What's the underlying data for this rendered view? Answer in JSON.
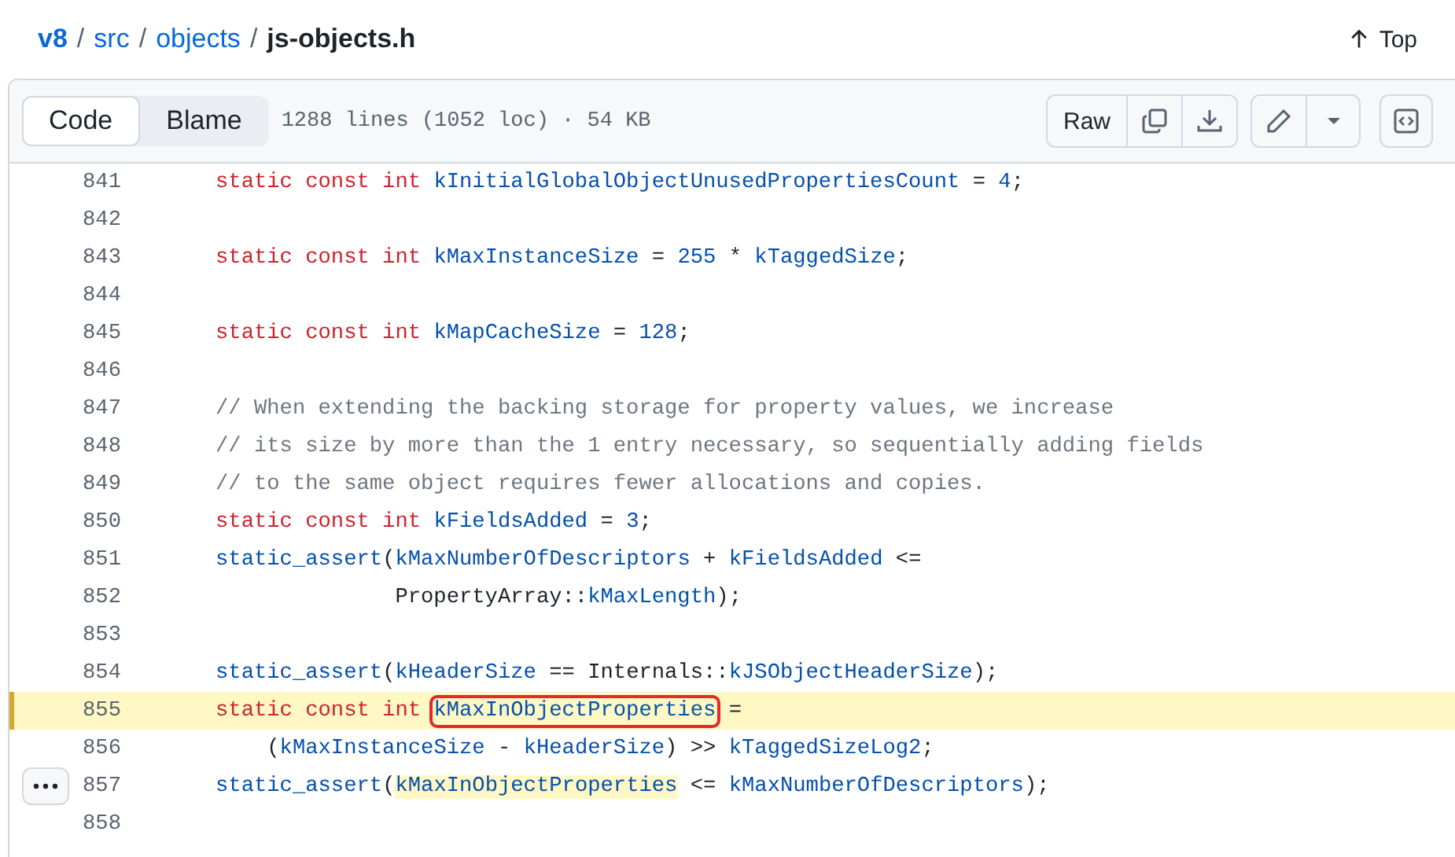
{
  "breadcrumb": {
    "items": [
      "v8",
      "src",
      "objects"
    ],
    "separator": "/",
    "current": "js-objects.h"
  },
  "top_link": {
    "label": "Top"
  },
  "toolbar": {
    "tabs": [
      {
        "label": "Code",
        "selected": true
      },
      {
        "label": "Blame",
        "selected": false
      }
    ],
    "file_info": "1288 lines (1052 loc) · 54 KB",
    "raw_button": "Raw"
  },
  "code": {
    "lines": [
      {
        "number": "841",
        "selected": false,
        "tokens": [
          {
            "t": "static const int ",
            "kind": "kw"
          },
          {
            "t": "kInitialGlobalObjectUnusedPropertiesCount",
            "kind": "id"
          },
          {
            "t": " = ",
            "kind": "p"
          },
          {
            "t": "4",
            "kind": "num"
          },
          {
            "t": ";",
            "kind": "p"
          }
        ]
      },
      {
        "number": "842",
        "selected": false
      },
      {
        "number": "843",
        "selected": false,
        "tokens": [
          {
            "t": "static const int ",
            "kind": "kw"
          },
          {
            "t": "kMaxInstanceSize",
            "kind": "id"
          },
          {
            "t": " = ",
            "kind": "p"
          },
          {
            "t": "255",
            "kind": "num"
          },
          {
            "t": " * ",
            "kind": "p"
          },
          {
            "t": "kTaggedSize",
            "kind": "id"
          },
          {
            "t": ";",
            "kind": "p"
          }
        ]
      },
      {
        "number": "844",
        "selected": false
      },
      {
        "number": "845",
        "selected": false,
        "tokens": [
          {
            "t": "static const int ",
            "kind": "kw"
          },
          {
            "t": "kMapCacheSize",
            "kind": "id"
          },
          {
            "t": " = ",
            "kind": "p"
          },
          {
            "t": "128",
            "kind": "num"
          },
          {
            "t": ";",
            "kind": "p"
          }
        ]
      },
      {
        "number": "846",
        "selected": false
      },
      {
        "number": "847",
        "selected": false,
        "tokens": [
          {
            "t": "// When extending the backing storage for property values, we increase",
            "kind": "comment"
          }
        ]
      },
      {
        "number": "848",
        "selected": false,
        "tokens": [
          {
            "t": "// its size by more than the 1 entry necessary, so sequentially adding fields",
            "kind": "comment"
          }
        ]
      },
      {
        "number": "849",
        "selected": false,
        "tokens": [
          {
            "t": "// to the same object requires fewer allocations and copies.",
            "kind": "comment"
          }
        ]
      },
      {
        "number": "850",
        "selected": false,
        "tokens": [
          {
            "t": "static const int ",
            "kind": "kw"
          },
          {
            "t": "kFieldsAdded",
            "kind": "id"
          },
          {
            "t": " = ",
            "kind": "p"
          },
          {
            "t": "3",
            "kind": "num"
          },
          {
            "t": ";",
            "kind": "p"
          }
        ]
      },
      {
        "number": "851",
        "selected": false,
        "tokens": [
          {
            "t": "static_assert",
            "kind": "id"
          },
          {
            "t": "(",
            "kind": "p"
          },
          {
            "t": "kMaxNumberOfDescriptors",
            "kind": "id"
          },
          {
            "t": " + ",
            "kind": "p"
          },
          {
            "t": "kFieldsAdded",
            "kind": "id"
          },
          {
            "t": " <=",
            "kind": "p"
          }
        ]
      },
      {
        "number": "852",
        "selected": false,
        "tokens": [
          {
            "t": "              PropertyArray::",
            "kind": "p"
          },
          {
            "t": "kMaxLength",
            "kind": "id"
          },
          {
            "t": ");",
            "kind": "p"
          }
        ]
      },
      {
        "number": "853",
        "selected": false
      },
      {
        "number": "854",
        "selected": false,
        "tokens": [
          {
            "t": "static_assert",
            "kind": "id"
          },
          {
            "t": "(",
            "kind": "p"
          },
          {
            "t": "kHeaderSize",
            "kind": "id"
          },
          {
            "t": " == Internals::",
            "kind": "p"
          },
          {
            "t": "kJSObjectHeaderSize",
            "kind": "id"
          },
          {
            "t": ");",
            "kind": "p"
          }
        ]
      },
      {
        "number": "855",
        "selected": true,
        "tokens": [
          {
            "t": "static const int ",
            "kind": "kw"
          },
          {
            "t": "kMaxInObjectProperties",
            "kind": "id",
            "boxed": true
          },
          {
            "t": " =",
            "kind": "p"
          }
        ]
      },
      {
        "number": "856",
        "selected": false,
        "tokens": [
          {
            "t": "    (",
            "kind": "p"
          },
          {
            "t": "kMaxInstanceSize",
            "kind": "id"
          },
          {
            "t": " - ",
            "kind": "p"
          },
          {
            "t": "kHeaderSize",
            "kind": "id"
          },
          {
            "t": ") >> ",
            "kind": "p"
          },
          {
            "t": "kTaggedSizeLog2",
            "kind": "id"
          },
          {
            "t": ";",
            "kind": "p"
          }
        ]
      },
      {
        "number": "857",
        "selected": false,
        "tokens": [
          {
            "t": "static_assert",
            "kind": "id"
          },
          {
            "t": "(",
            "kind": "p"
          },
          {
            "t": "kMaxInObjectProperties",
            "kind": "id",
            "match": true
          },
          {
            "t": " <= ",
            "kind": "p"
          },
          {
            "t": "kMaxNumberOfDescriptors",
            "kind": "id"
          },
          {
            "t": ");",
            "kind": "p"
          }
        ]
      },
      {
        "number": "858",
        "selected": false
      }
    ]
  }
}
